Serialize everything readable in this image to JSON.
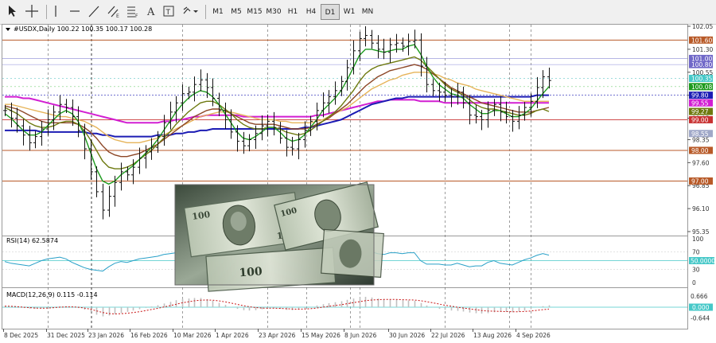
{
  "toolbar": {
    "timeframes": [
      "M1",
      "M5",
      "M15",
      "M30",
      "H1",
      "H4",
      "D1",
      "W1",
      "MN"
    ],
    "active": "D1"
  },
  "symbol": {
    "header": "#USDX,Daily  100.22 100.35 100.17 100.28",
    "open": 100.22,
    "high": 100.35,
    "low": 100.17,
    "close": 100.28
  },
  "colors": {
    "hline": "#b85a28",
    "ma_blue": "#1c1cb4",
    "ma_magenta": "#d21ed2",
    "ma_green": "#1e9a1e",
    "ma_olive": "#6e7a10",
    "ma_brown": "#8c4626",
    "ma_orange": "#e6b45a",
    "ma_violet": "#c882c8",
    "ma_darkred": "#b43232",
    "rsi": "#28a0c8",
    "macd_hist": "#c0c0c0",
    "macd_signal": "#c81414"
  },
  "chart_data": [
    {
      "type": "line",
      "title": "#USDX,Daily  100.22 100.35 100.17 100.28",
      "x_tick_labels": [
        "8 Dec 2025",
        "31 Dec 2025",
        "23 Jan 2026",
        "16 Feb 2026",
        "10 Mar 2026",
        "1 Apr 2026",
        "23 Apr 2026",
        "15 May 2026",
        "8 Jun 2026",
        "30 Jun 2026",
        "22 Jul 2026",
        "13 Aug 2026",
        "4 Sep 2026"
      ],
      "y_tick_labels": [
        "102.05",
        "101.30",
        "100.55",
        "99.80",
        "99.05",
        "98.35",
        "97.60",
        "96.85",
        "96.10",
        "95.35"
      ],
      "ylim": [
        95.35,
        102.05
      ],
      "horizontal_levels": [
        {
          "label": "101.60",
          "value": 101.6,
          "color": "#b85a28"
        },
        {
          "label": "98.00",
          "value": 98.0,
          "color": "#b85a28"
        },
        {
          "label": "97.00",
          "value": 97.0,
          "color": "#b85a28"
        }
      ],
      "price_badges": [
        {
          "label": "101.00",
          "value": 101.0,
          "color": "#7068c8"
        },
        {
          "label": "100.80",
          "value": 100.8,
          "color": "#7068c8"
        },
        {
          "label": "100.35",
          "value": 100.35,
          "color": "#46c8c8"
        },
        {
          "label": "100.08",
          "value": 100.08,
          "color": "#1e9a1e"
        },
        {
          "label": "99.80",
          "value": 99.8,
          "color": "#1c1cb4"
        },
        {
          "label": "99.55",
          "value": 99.55,
          "color": "#d21ed2"
        },
        {
          "label": "99.27",
          "value": 99.27,
          "color": "#6e7a10"
        },
        {
          "label": "99.00",
          "value": 99.0,
          "color": "#c83232"
        },
        {
          "label": "98.55",
          "value": 98.55,
          "color": "#a0a8c8"
        }
      ],
      "close_series": [
        99.3,
        99.05,
        98.8,
        98.5,
        98.25,
        98.45,
        98.7,
        99.0,
        99.25,
        99.5,
        99.4,
        99.1,
        98.65,
        98.05,
        97.3,
        96.65,
        96.05,
        96.5,
        96.95,
        97.3,
        97.2,
        97.45,
        97.75,
        97.95,
        98.1,
        98.45,
        98.9,
        99.25,
        99.55,
        99.85,
        99.9,
        100.15,
        100.3,
        100.05,
        99.7,
        99.3,
        99.0,
        98.6,
        98.3,
        98.15,
        98.35,
        98.55,
        98.8,
        98.95,
        98.75,
        98.4,
        98.1,
        98.05,
        98.35,
        98.65,
        98.95,
        99.3,
        99.55,
        99.75,
        99.95,
        100.25,
        100.7,
        101.25,
        101.65,
        101.75,
        101.5,
        101.3,
        101.2,
        101.45,
        101.5,
        101.4,
        101.55,
        101.6,
        100.75,
        100.15,
        99.95,
        99.9,
        99.8,
        99.75,
        99.9,
        99.55,
        99.15,
        99.1,
        99.0,
        99.3,
        99.5,
        99.25,
        99.1,
        98.95,
        99.15,
        99.4,
        99.6,
        100.05,
        100.4,
        100.28
      ],
      "moving_averages": [
        {
          "color": "#1e9a1e",
          "values": [
            99.2,
            99.05,
            98.85,
            98.65,
            98.5,
            98.5,
            98.6,
            98.8,
            99.0,
            99.2,
            99.3,
            99.2,
            98.95,
            98.5,
            97.95,
            97.4,
            97.0,
            96.9,
            97.0,
            97.2,
            97.35,
            97.5,
            97.7,
            97.9,
            98.1,
            98.35,
            98.65,
            98.95,
            99.25,
            99.5,
            99.7,
            99.85,
            99.95,
            99.9,
            99.75,
            99.5,
            99.2,
            98.9,
            98.6,
            98.4,
            98.35,
            98.45,
            98.6,
            98.75,
            98.75,
            98.6,
            98.4,
            98.3,
            98.35,
            98.5,
            98.75,
            99.0,
            99.3,
            99.5,
            99.7,
            99.95,
            100.3,
            100.7,
            101.1,
            101.3,
            101.3,
            101.25,
            101.2,
            101.25,
            101.3,
            101.3,
            101.4,
            101.45,
            101.15,
            100.75,
            100.4,
            100.15,
            100.0,
            99.85,
            99.8,
            99.7,
            99.5,
            99.35,
            99.2,
            99.2,
            99.3,
            99.3,
            99.2,
            99.1,
            99.1,
            99.2,
            99.35,
            99.6,
            99.85,
            100.08
          ]
        },
        {
          "color": "#6e7a10",
          "values": [
            99.4,
            99.3,
            99.2,
            99.05,
            98.9,
            98.8,
            98.75,
            98.75,
            98.8,
            98.9,
            98.95,
            98.95,
            98.85,
            98.65,
            98.35,
            98.0,
            97.65,
            97.45,
            97.4,
            97.4,
            97.45,
            97.55,
            97.7,
            97.85,
            98.0,
            98.2,
            98.4,
            98.6,
            98.85,
            99.05,
            99.25,
            99.4,
            99.55,
            99.6,
            99.6,
            99.5,
            99.35,
            99.2,
            99.0,
            98.85,
            98.75,
            98.7,
            98.7,
            98.75,
            98.75,
            98.7,
            98.6,
            98.55,
            98.5,
            98.55,
            98.65,
            98.8,
            98.95,
            99.1,
            99.25,
            99.45,
            99.7,
            99.95,
            100.25,
            100.5,
            100.65,
            100.75,
            100.8,
            100.85,
            100.9,
            100.95,
            101.0,
            101.05,
            100.95,
            100.75,
            100.55,
            100.35,
            100.15,
            100.0,
            99.9,
            99.8,
            99.65,
            99.5,
            99.4,
            99.35,
            99.35,
            99.3,
            99.25,
            99.2,
            99.15,
            99.15,
            99.2,
            99.3,
            99.35,
            99.27
          ]
        },
        {
          "color": "#8c4626",
          "values": [
            99.45,
            99.4,
            99.35,
            99.25,
            99.15,
            99.05,
            98.95,
            98.9,
            98.9,
            98.9,
            98.9,
            98.9,
            98.85,
            98.75,
            98.6,
            98.4,
            98.15,
            97.95,
            97.85,
            97.8,
            97.8,
            97.85,
            97.9,
            98.0,
            98.1,
            98.2,
            98.35,
            98.5,
            98.65,
            98.8,
            98.95,
            99.1,
            99.2,
            99.3,
            99.35,
            99.35,
            99.3,
            99.2,
            99.1,
            99.0,
            98.9,
            98.85,
            98.85,
            98.85,
            98.85,
            98.8,
            98.75,
            98.7,
            98.7,
            98.7,
            98.75,
            98.85,
            98.95,
            99.05,
            99.2,
            99.35,
            99.5,
            99.7,
            99.9,
            100.1,
            100.25,
            100.4,
            100.5,
            100.6,
            100.65,
            100.7,
            100.75,
            100.8,
            100.75,
            100.65,
            100.5,
            100.35,
            100.2,
            100.05,
            99.95,
            99.85,
            99.75,
            99.65,
            99.55,
            99.5,
            99.45,
            99.4,
            99.35,
            99.3,
            99.25,
            99.25,
            99.25,
            99.3,
            99.35,
            99.4
          ]
        },
        {
          "color": "#e6b45a",
          "values": [
            99.5,
            99.5,
            99.45,
            99.4,
            99.35,
            99.3,
            99.25,
            99.2,
            99.15,
            99.1,
            99.1,
            99.05,
            99.0,
            98.95,
            98.85,
            98.75,
            98.6,
            98.45,
            98.35,
            98.3,
            98.25,
            98.25,
            98.25,
            98.3,
            98.35,
            98.4,
            98.5,
            98.6,
            98.7,
            98.8,
            98.9,
            99.0,
            99.1,
            99.15,
            99.2,
            99.25,
            99.25,
            99.25,
            99.2,
            99.15,
            99.1,
            99.05,
            99.0,
            99.0,
            99.0,
            98.95,
            98.95,
            98.9,
            98.9,
            98.9,
            98.9,
            98.95,
            99.0,
            99.1,
            99.2,
            99.3,
            99.4,
            99.55,
            99.7,
            99.85,
            100.0,
            100.1,
            100.2,
            100.3,
            100.35,
            100.45,
            100.5,
            100.55,
            100.55,
            100.55,
            100.5,
            100.45,
            100.35,
            100.3,
            100.2,
            100.15,
            100.1,
            100.0,
            99.95,
            99.9,
            99.85,
            99.8,
            99.75,
            99.7,
            99.65,
            99.6,
            99.6,
            99.6,
            99.6,
            99.6
          ]
        },
        {
          "color": "#1c1cb4",
          "values": [
            98.65,
            98.65,
            98.65,
            98.65,
            98.65,
            98.65,
            98.6,
            98.6,
            98.6,
            98.6,
            98.6,
            98.6,
            98.6,
            98.6,
            98.55,
            98.55,
            98.5,
            98.5,
            98.45,
            98.45,
            98.45,
            98.45,
            98.45,
            98.45,
            98.45,
            98.5,
            98.5,
            98.5,
            98.55,
            98.55,
            98.6,
            98.6,
            98.65,
            98.65,
            98.7,
            98.7,
            98.7,
            98.7,
            98.7,
            98.7,
            98.7,
            98.7,
            98.7,
            98.7,
            98.7,
            98.7,
            98.7,
            98.7,
            98.7,
            98.75,
            98.75,
            98.8,
            98.85,
            98.9,
            98.95,
            99.0,
            99.1,
            99.2,
            99.3,
            99.4,
            99.5,
            99.55,
            99.6,
            99.65,
            99.7,
            99.7,
            99.75,
            99.75,
            99.75,
            99.75,
            99.75,
            99.75,
            99.75,
            99.75,
            99.75,
            99.75,
            99.75,
            99.75,
            99.75,
            99.75,
            99.75,
            99.75,
            99.75,
            99.75,
            99.75,
            99.75,
            99.75,
            99.8,
            99.8,
            99.8
          ]
        },
        {
          "color": "#d21ed2",
          "values": [
            99.75,
            99.75,
            99.75,
            99.7,
            99.7,
            99.65,
            99.6,
            99.55,
            99.5,
            99.45,
            99.4,
            99.35,
            99.3,
            99.25,
            99.2,
            99.15,
            99.1,
            99.05,
            99.0,
            98.95,
            98.9,
            98.9,
            98.9,
            98.9,
            98.9,
            98.9,
            98.95,
            98.95,
            99.0,
            99.0,
            99.05,
            99.1,
            99.1,
            99.15,
            99.15,
            99.15,
            99.15,
            99.15,
            99.15,
            99.1,
            99.1,
            99.1,
            99.1,
            99.1,
            99.1,
            99.1,
            99.1,
            99.1,
            99.1,
            99.1,
            99.1,
            99.15,
            99.15,
            99.2,
            99.25,
            99.3,
            99.35,
            99.4,
            99.45,
            99.5,
            99.55,
            99.6,
            99.6,
            99.65,
            99.65,
            99.65,
            99.65,
            99.65,
            99.6,
            99.6,
            99.6,
            99.6,
            99.55,
            99.55,
            99.55,
            99.55,
            99.55,
            99.55,
            99.55,
            99.55,
            99.55,
            99.55,
            99.55,
            99.55,
            99.55,
            99.55,
            99.55,
            99.55,
            99.55,
            99.55
          ]
        }
      ]
    },
    {
      "type": "line",
      "title": "RSI(14) 62.5874",
      "current": 62.5874,
      "levels": [
        {
          "label": "50.0000",
          "value": 50
        }
      ],
      "y_tick_labels": [
        "100",
        "70",
        "50",
        "30",
        "0"
      ],
      "ylim": [
        0,
        100
      ],
      "values": [
        48,
        44,
        42,
        40,
        38,
        44,
        50,
        54,
        56,
        58,
        54,
        46,
        40,
        34,
        30,
        28,
        26,
        36,
        44,
        48,
        46,
        50,
        54,
        56,
        58,
        60,
        64,
        66,
        68,
        70,
        68,
        72,
        70,
        60,
        52,
        46,
        42,
        40,
        38,
        38,
        42,
        46,
        50,
        52,
        46,
        40,
        36,
        38,
        46,
        52,
        56,
        60,
        62,
        64,
        66,
        68,
        72,
        76,
        78,
        78,
        70,
        66,
        64,
        68,
        68,
        66,
        68,
        68,
        50,
        42,
        42,
        42,
        40,
        40,
        44,
        40,
        36,
        38,
        38,
        46,
        50,
        44,
        42,
        40,
        46,
        52,
        56,
        62,
        66,
        62.59
      ]
    },
    {
      "type": "bar",
      "title": "MACD(12,26,9) 0.115 -0.114",
      "macd": 0.115,
      "signal_value": -0.114,
      "levels": [
        {
          "label": "0.000",
          "value": 0
        }
      ],
      "y_tick_labels": [
        "0.666",
        "0.000",
        "-0.644"
      ],
      "ylim": [
        -0.644,
        0.666
      ],
      "histogram": [
        0.05,
        0.03,
        0.0,
        -0.04,
        -0.08,
        -0.08,
        -0.06,
        -0.02,
        0.02,
        0.05,
        0.05,
        0.02,
        -0.05,
        -0.15,
        -0.3,
        -0.45,
        -0.55,
        -0.5,
        -0.42,
        -0.35,
        -0.28,
        -0.2,
        -0.12,
        -0.04,
        0.04,
        0.12,
        0.22,
        0.32,
        0.42,
        0.5,
        0.52,
        0.55,
        0.55,
        0.48,
        0.38,
        0.26,
        0.14,
        0.02,
        -0.1,
        -0.18,
        -0.2,
        -0.18,
        -0.12,
        -0.06,
        -0.06,
        -0.1,
        -0.16,
        -0.18,
        -0.14,
        -0.08,
        0.0,
        0.1,
        0.18,
        0.24,
        0.3,
        0.36,
        0.44,
        0.52,
        0.6,
        0.62,
        0.58,
        0.52,
        0.48,
        0.46,
        0.44,
        0.42,
        0.4,
        0.38,
        0.25,
        0.1,
        -0.02,
        -0.1,
        -0.16,
        -0.2,
        -0.22,
        -0.26,
        -0.32,
        -0.36,
        -0.38,
        -0.36,
        -0.3,
        -0.28,
        -0.28,
        -0.3,
        -0.26,
        -0.2,
        -0.12,
        -0.02,
        0.06,
        0.115
      ],
      "signal": [
        0.06,
        0.05,
        0.03,
        0.0,
        -0.03,
        -0.05,
        -0.06,
        -0.05,
        -0.03,
        0.0,
        0.02,
        0.02,
        0.0,
        -0.05,
        -0.12,
        -0.22,
        -0.32,
        -0.38,
        -0.4,
        -0.39,
        -0.36,
        -0.32,
        -0.27,
        -0.21,
        -0.14,
        -0.07,
        0.01,
        0.09,
        0.17,
        0.26,
        0.32,
        0.38,
        0.42,
        0.43,
        0.42,
        0.38,
        0.32,
        0.25,
        0.17,
        0.09,
        0.03,
        -0.02,
        -0.05,
        -0.06,
        -0.06,
        -0.07,
        -0.09,
        -0.11,
        -0.12,
        -0.11,
        -0.09,
        -0.05,
        0.0,
        0.05,
        0.1,
        0.15,
        0.21,
        0.27,
        0.33,
        0.39,
        0.43,
        0.45,
        0.46,
        0.46,
        0.46,
        0.45,
        0.44,
        0.43,
        0.39,
        0.33,
        0.26,
        0.19,
        0.12,
        0.06,
        0.0,
        -0.05,
        -0.1,
        -0.15,
        -0.2,
        -0.23,
        -0.24,
        -0.25,
        -0.26,
        -0.27,
        -0.27,
        -0.25,
        -0.23,
        -0.19,
        -0.15,
        -0.114
      ]
    }
  ]
}
